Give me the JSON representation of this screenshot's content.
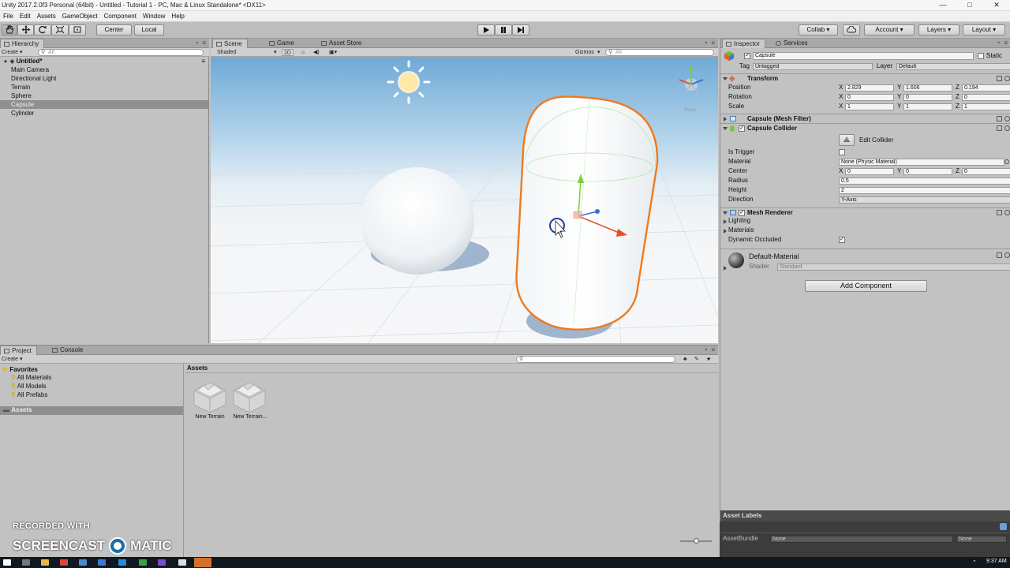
{
  "window": {
    "title": "Unity 2017.2.0f3 Personal (64bit) - Untitled - Tutorial 1 - PC, Mac & Linux Standalone* <DX11>",
    "controls": [
      "—",
      "□",
      "✕"
    ]
  },
  "menu": [
    "File",
    "Edit",
    "Assets",
    "GameObject",
    "Component",
    "Window",
    "Help"
  ],
  "toolbar": {
    "pivot": "Center",
    "space": "Local",
    "collab": "Collab ▾",
    "account": "Account",
    "layers": "Layers",
    "layout": "Layout"
  },
  "hierarchy": {
    "tab": "Hierarchy",
    "create": "Create ▾",
    "search_placeholder": "All",
    "scene_name": "Untitled*",
    "items": [
      {
        "label": "Main Camera",
        "selected": false
      },
      {
        "label": "Directional Light",
        "selected": false
      },
      {
        "label": "Terrain",
        "selected": false
      },
      {
        "label": "Sphere",
        "selected": false
      },
      {
        "label": "Capsule",
        "selected": true
      },
      {
        "label": "Cylinder",
        "selected": false
      }
    ]
  },
  "scene": {
    "tabs": [
      "Scene",
      "Game",
      "Asset Store"
    ],
    "shading": "Shaded",
    "mode_2d": "2D",
    "gizmos": "Gizmos",
    "search_placeholder": "All",
    "persp_label": "Persp",
    "selection_color": "#f07a1c",
    "sky_color": "#6fa9d6"
  },
  "inspector": {
    "tabs": [
      "Inspector",
      "Services"
    ],
    "object_name": "Capsule",
    "static_label": "Static",
    "tag_label": "Tag",
    "tag_value": "Untagged",
    "layer_label": "Layer",
    "layer_value": "Default",
    "transform": {
      "title": "Transform",
      "rows": [
        {
          "label": "Position",
          "x": "2.829",
          "y": "1.606",
          "z": "0.194"
        },
        {
          "label": "Rotation",
          "x": "0",
          "y": "0",
          "z": "0"
        },
        {
          "label": "Scale",
          "x": "1",
          "y": "1",
          "z": "1"
        }
      ]
    },
    "mesh_filter": {
      "title": "Capsule (Mesh Filter)"
    },
    "capsule_collider": {
      "title": "Capsule Collider",
      "edit_label": "Edit Collider",
      "is_trigger_label": "Is Trigger",
      "material_label": "Material",
      "material_value": "None (Physic Material)",
      "center_label": "Center",
      "center": {
        "x": "0",
        "y": "0",
        "z": "0"
      },
      "radius_label": "Radius",
      "radius_value": "0.5",
      "height_label": "Height",
      "height_value": "2",
      "direction_label": "Direction",
      "direction_value": "Y-Axis"
    },
    "mesh_renderer": {
      "title": "Mesh Renderer",
      "lighting": "Lighting",
      "materials": "Materials",
      "dynamic_occluded": "Dynamic Occluded"
    },
    "material": {
      "name": "Default-Material",
      "shader_label": "Shader",
      "shader_value": "Standard"
    },
    "add_component": "Add Component",
    "asset_labels": "Asset Labels",
    "asset_bundle_label": "AssetBundle",
    "asset_bundle_value": "None",
    "asset_bundle_variant": "None"
  },
  "project": {
    "tabs": [
      "Project",
      "Console"
    ],
    "create": "Create ▾",
    "favorites": "Favorites",
    "favorite_items": [
      "All Materials",
      "All Models",
      "All Prefabs"
    ],
    "assets_root": "Assets",
    "assets_header": "Assets",
    "assets": [
      {
        "label": "New Terrain"
      },
      {
        "label": "New Terrain..."
      }
    ]
  },
  "watermark": {
    "line1": "RECORDED WITH",
    "brand_left": "SCREENCAST",
    "brand_right": "MATIC"
  },
  "taskbar": {
    "clock": "9:37 AM"
  }
}
